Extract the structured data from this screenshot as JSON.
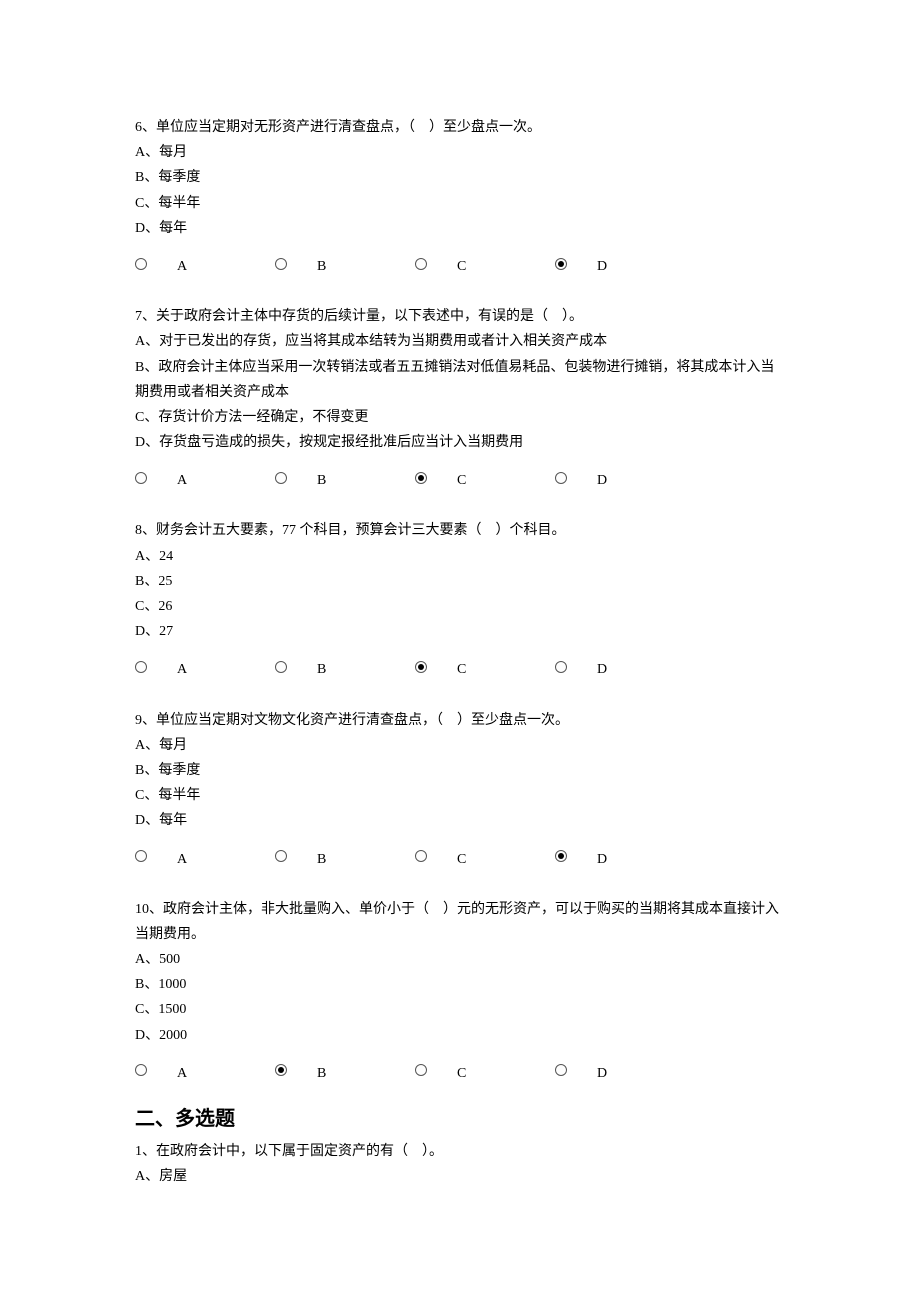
{
  "questions": [
    {
      "lines": [
        "6、单位应当定期对无形资产进行清查盘点，（    ）至少盘点一次。",
        "A、每月",
        "B、每季度",
        "C、每半年",
        "D、每年"
      ],
      "options": [
        "A",
        "B",
        "C",
        "D"
      ],
      "selected": 3
    },
    {
      "lines": [
        "7、关于政府会计主体中存货的后续计量，以下表述中，有误的是（    ）。",
        "A、对于已发出的存货，应当将其成本结转为当期费用或者计入相关资产成本",
        "B、政府会计主体应当采用一次转销法或者五五摊销法对低值易耗品、包装物进行摊销，将其成本计入当期费用或者相关资产成本",
        "C、存货计价方法一经确定，不得变更",
        "D、存货盘亏造成的损失，按规定报经批准后应当计入当期费用"
      ],
      "options": [
        "A",
        "B",
        "C",
        "D"
      ],
      "selected": 2
    },
    {
      "lines": [
        "8、财务会计五大要素，77 个科目，预算会计三大要素（    ）个科目。",
        "A、24",
        "B、25",
        "C、26",
        "D、27"
      ],
      "options": [
        "A",
        "B",
        "C",
        "D"
      ],
      "selected": 2
    },
    {
      "lines": [
        "9、单位应当定期对文物文化资产进行清查盘点，（    ）至少盘点一次。",
        "A、每月",
        "B、每季度",
        "C、每半年",
        "D、每年"
      ],
      "options": [
        "A",
        "B",
        "C",
        "D"
      ],
      "selected": 3
    },
    {
      "lines": [
        "10、政府会计主体，非大批量购入、单价小于（    ）元的无形资产，可以于购买的当期将其成本直接计入当期费用。",
        "A、500",
        "B、1000",
        "C、1500",
        "D、2000"
      ],
      "options": [
        "A",
        "B",
        "C",
        "D"
      ],
      "selected": 1
    }
  ],
  "section2": {
    "heading": "二、多选题",
    "q1_lines": [
      "1、在政府会计中，以下属于固定资产的有（    ）。",
      "A、房屋"
    ]
  }
}
